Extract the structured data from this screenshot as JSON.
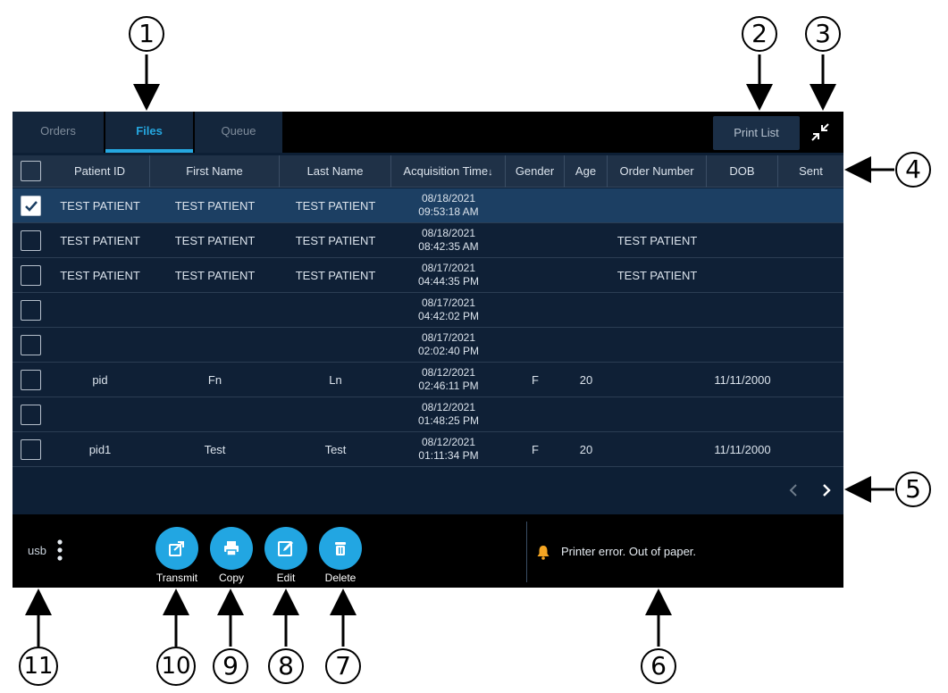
{
  "tabs": [
    {
      "label": "Orders",
      "active": false
    },
    {
      "label": "Files",
      "active": true
    },
    {
      "label": "Queue",
      "active": false
    }
  ],
  "toolbar": {
    "print_list_label": "Print List",
    "collapse_icon": "collapse-arrows-icon"
  },
  "table": {
    "columns": [
      "Patient ID",
      "First Name",
      "Last Name",
      "Acquisition Time",
      "Gender",
      "Age",
      "Order Number",
      "DOB",
      "Sent"
    ],
    "sort_indicator": "↓",
    "rows": [
      {
        "checked": true,
        "patient_id": "TEST PATIENT",
        "first_name": "TEST PATIENT",
        "last_name": "TEST PATIENT",
        "date": "08/18/2021",
        "time": "09:53:18 AM",
        "gender": "",
        "age": "",
        "order_number": "",
        "dob": "",
        "sent": ""
      },
      {
        "checked": false,
        "patient_id": "TEST PATIENT",
        "first_name": "TEST PATIENT",
        "last_name": "TEST PATIENT",
        "date": "08/18/2021",
        "time": "08:42:35 AM",
        "gender": "",
        "age": "",
        "order_number": "TEST PATIENT",
        "dob": "",
        "sent": ""
      },
      {
        "checked": false,
        "patient_id": "TEST PATIENT",
        "first_name": "TEST PATIENT",
        "last_name": "TEST PATIENT",
        "date": "08/17/2021",
        "time": "04:44:35 PM",
        "gender": "",
        "age": "",
        "order_number": "TEST PATIENT",
        "dob": "",
        "sent": ""
      },
      {
        "checked": false,
        "patient_id": "",
        "first_name": "",
        "last_name": "",
        "date": "08/17/2021",
        "time": "04:42:02 PM",
        "gender": "",
        "age": "",
        "order_number": "",
        "dob": "",
        "sent": ""
      },
      {
        "checked": false,
        "patient_id": "",
        "first_name": "",
        "last_name": "",
        "date": "08/17/2021",
        "time": "02:02:40 PM",
        "gender": "",
        "age": "",
        "order_number": "",
        "dob": "",
        "sent": ""
      },
      {
        "checked": false,
        "patient_id": "pid",
        "first_name": "Fn",
        "last_name": "Ln",
        "date": "08/12/2021",
        "time": "02:46:11 PM",
        "gender": "F",
        "age": "20",
        "order_number": "",
        "dob": "11/11/2000",
        "sent": ""
      },
      {
        "checked": false,
        "patient_id": "",
        "first_name": "",
        "last_name": "",
        "date": "08/12/2021",
        "time": "01:48:25 PM",
        "gender": "",
        "age": "",
        "order_number": "",
        "dob": "",
        "sent": ""
      },
      {
        "checked": false,
        "patient_id": "pid1",
        "first_name": "Test",
        "last_name": "Test",
        "date": "08/12/2021",
        "time": "01:11:34 PM",
        "gender": "F",
        "age": "20",
        "order_number": "",
        "dob": "11/11/2000",
        "sent": ""
      }
    ]
  },
  "pagination": {
    "prev_icon": "chevron-left-icon",
    "next_icon": "chevron-right-icon"
  },
  "bottom": {
    "device_label": "usb",
    "menu_icon": "vertical-dots-icon",
    "actions": [
      {
        "label": "Transmit",
        "icon": "share-icon"
      },
      {
        "label": "Copy",
        "icon": "printer-icon"
      },
      {
        "label": "Edit",
        "icon": "edit-icon"
      },
      {
        "label": "Delete",
        "icon": "trash-icon"
      }
    ],
    "status": {
      "icon": "bell-icon",
      "text": "Printer error. Out of paper.",
      "icon_color": "#f5a623"
    }
  },
  "callouts": [
    "1",
    "2",
    "3",
    "4",
    "5",
    "6",
    "7",
    "8",
    "9",
    "10",
    "11"
  ],
  "colors": {
    "accent": "#25a7e0",
    "screen_bg": "#0d1f35",
    "selected_row": "#1c3f63",
    "header_bg": "#1f3147"
  }
}
